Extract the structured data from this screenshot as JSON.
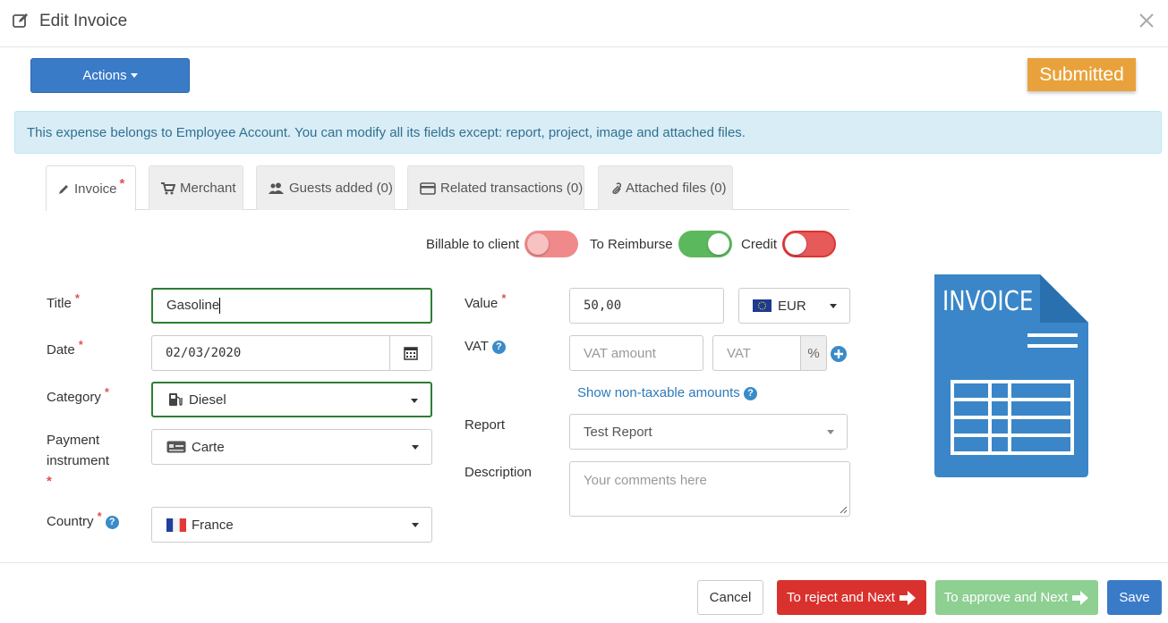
{
  "header": {
    "title": "Edit Invoice"
  },
  "toolbar": {
    "actions_label": "Actions",
    "status": "Submitted"
  },
  "alert": {
    "text": "This expense belongs to Employee Account. You can modify all its fields except: report, project, image and attached files."
  },
  "tabs": [
    {
      "label": "Invoice",
      "required": "*"
    },
    {
      "label": "Merchant"
    },
    {
      "label": "Guests added (0)"
    },
    {
      "label": "Related transactions (0)"
    },
    {
      "label": "Attached files (0)"
    }
  ],
  "toggles": {
    "billable": {
      "label": "Billable to client",
      "state": "off"
    },
    "reimburse": {
      "label": "To Reimburse",
      "state": "on"
    },
    "credit": {
      "label": "Credit",
      "state": "off"
    }
  },
  "form": {
    "required_mark": "*",
    "title": {
      "label": "Title",
      "value": "Gasoline"
    },
    "date": {
      "label": "Date",
      "value": "02/03/2020"
    },
    "category": {
      "label": "Category",
      "value": "Diesel"
    },
    "payment": {
      "label_line1": "Payment",
      "label_line2": "instrument",
      "value": "Carte"
    },
    "country": {
      "label": "Country",
      "value": "France"
    },
    "value": {
      "label": "Value",
      "amount": "50,00",
      "currency": "EUR"
    },
    "vat": {
      "label": "VAT",
      "amount_placeholder": "VAT amount",
      "rate_placeholder": "VAT",
      "percent": "%"
    },
    "non_taxable_link": "Show non-taxable amounts",
    "report": {
      "label": "Report",
      "value": "Test Report"
    },
    "description": {
      "label": "Description",
      "placeholder": "Your comments here"
    }
  },
  "graphic": {
    "text": "INVOICE",
    "color": "#3a86c8"
  },
  "footer": {
    "cancel": "Cancel",
    "reject": "To reject and Next",
    "approve": "To approve and Next",
    "save": "Save"
  }
}
